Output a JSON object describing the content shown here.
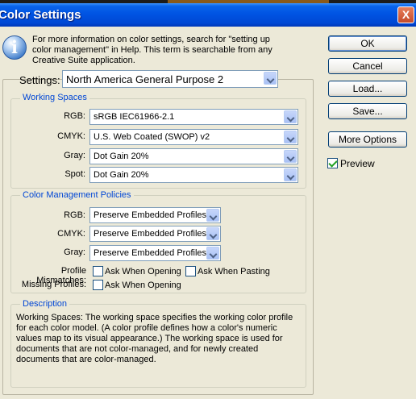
{
  "window": {
    "title": "Color Settings",
    "close_glyph": "X"
  },
  "info": {
    "icon": "i",
    "text": "For more information on color settings, search for \"setting up color management\" in Help. This term is searchable from any Creative Suite application."
  },
  "settings": {
    "label": "Settings:",
    "value": "North America General Purpose 2"
  },
  "working_spaces": {
    "title": "Working Spaces",
    "rows": [
      {
        "label": "RGB:",
        "value": "sRGB IEC61966-2.1"
      },
      {
        "label": "CMYK:",
        "value": "U.S. Web Coated (SWOP) v2"
      },
      {
        "label": "Gray:",
        "value": "Dot Gain 20%"
      },
      {
        "label": "Spot:",
        "value": "Dot Gain 20%"
      }
    ]
  },
  "policies": {
    "title": "Color Management Policies",
    "rows": [
      {
        "label": "RGB:",
        "value": "Preserve Embedded Profiles"
      },
      {
        "label": "CMYK:",
        "value": "Preserve Embedded Profiles"
      },
      {
        "label": "Gray:",
        "value": "Preserve Embedded Profiles"
      }
    ],
    "profile_mismatches": {
      "label": "Profile Mismatches:",
      "ask_opening": "Ask When Opening",
      "ask_pasting": "Ask When Pasting"
    },
    "missing_profiles": {
      "label": "Missing Profiles:",
      "ask_opening": "Ask When Opening"
    }
  },
  "description": {
    "title": "Description",
    "text": "Working Spaces:  The working space specifies the working color profile for each color model.  (A color profile defines how a color's numeric values map to its visual appearance.)  The working space is used for documents that are not color-managed, and for newly created documents that are color-managed."
  },
  "buttons": {
    "ok": "OK",
    "cancel": "Cancel",
    "load": "Load...",
    "save": "Save...",
    "more_options": "More Options"
  },
  "preview": {
    "label": "Preview",
    "checked": true
  },
  "colors": {
    "titlebar": "#0054e3",
    "group_title": "#0046d5",
    "dialog_bg": "#ece9d8"
  }
}
